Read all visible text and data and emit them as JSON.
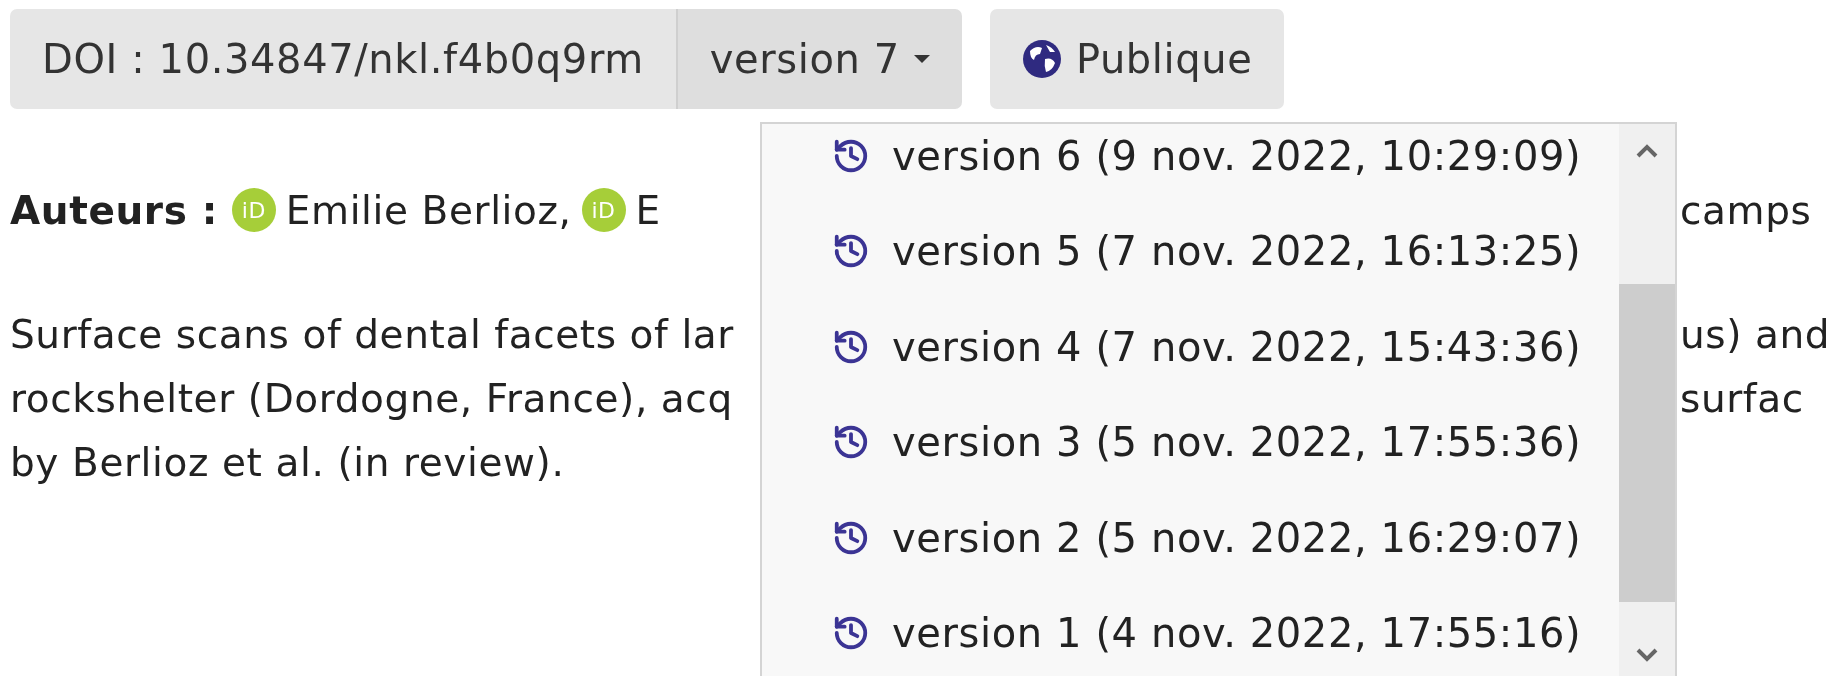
{
  "toolbar": {
    "doi": "DOI : 10.34847/nkl.f4b0q9rm",
    "version": {
      "label": "version 7",
      "expanded": true
    },
    "visibility": "Publique"
  },
  "versions": [
    "version 6 (9 nov. 2022, 10:29:09)",
    "version 5 (7 nov. 2022, 16:13:25)",
    "version 4 (7 nov. 2022, 15:43:36)",
    "version 3 (5 nov. 2022, 17:55:36)",
    "version 2 (5 nov. 2022, 16:29:07)",
    "version 1 (4 nov. 2022, 17:55:16)"
  ],
  "authors": {
    "label": "Auteurs :",
    "people": [
      {
        "badge": "iD",
        "name": "Emilie Berlioz,"
      },
      {
        "badge": "iD",
        "name": "E"
      }
    ],
    "tail": "camps"
  },
  "description": [
    {
      "left": "Surface scans of dental facets of lar",
      "right": "us) and"
    },
    {
      "left": "rockshelter (Dordogne, France), acq",
      "right": "surfac"
    },
    {
      "left": "by Berlioz et al. (in review)."
    }
  ]
}
